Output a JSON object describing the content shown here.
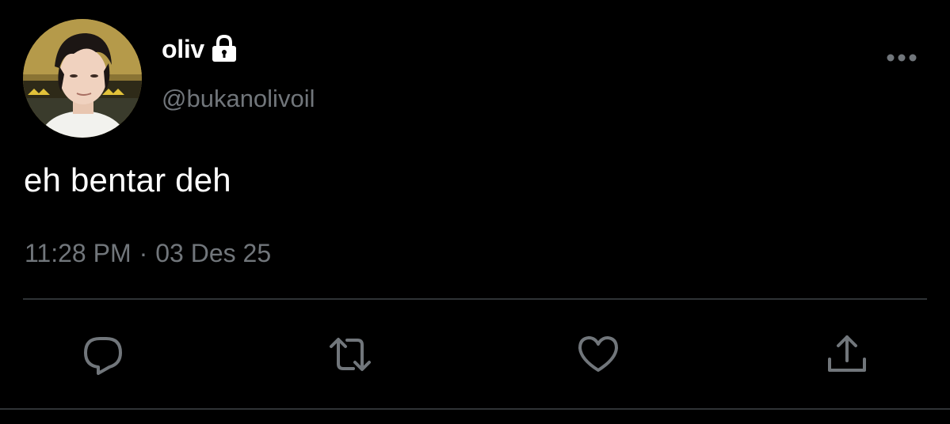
{
  "user": {
    "display_name": "oliv",
    "handle": "@bukanolivoil",
    "protected_icon": "lock-icon",
    "avatar_icon": "avatar"
  },
  "tweet": {
    "text": "eh bentar deh",
    "time": "11:28 PM",
    "separator": "·",
    "date": "03 Des 25"
  },
  "actions": [
    {
      "name": "reply",
      "icon": "reply-icon"
    },
    {
      "name": "retweet",
      "icon": "retweet-icon"
    },
    {
      "name": "like",
      "icon": "heart-icon"
    },
    {
      "name": "share",
      "icon": "share-icon"
    }
  ],
  "menu": {
    "icon": "more-options-icon"
  },
  "colors": {
    "background": "#000000",
    "primary_text": "#ffffff",
    "secondary_text": "#71767b",
    "divider": "#2f3336",
    "icon": "#71767b"
  }
}
